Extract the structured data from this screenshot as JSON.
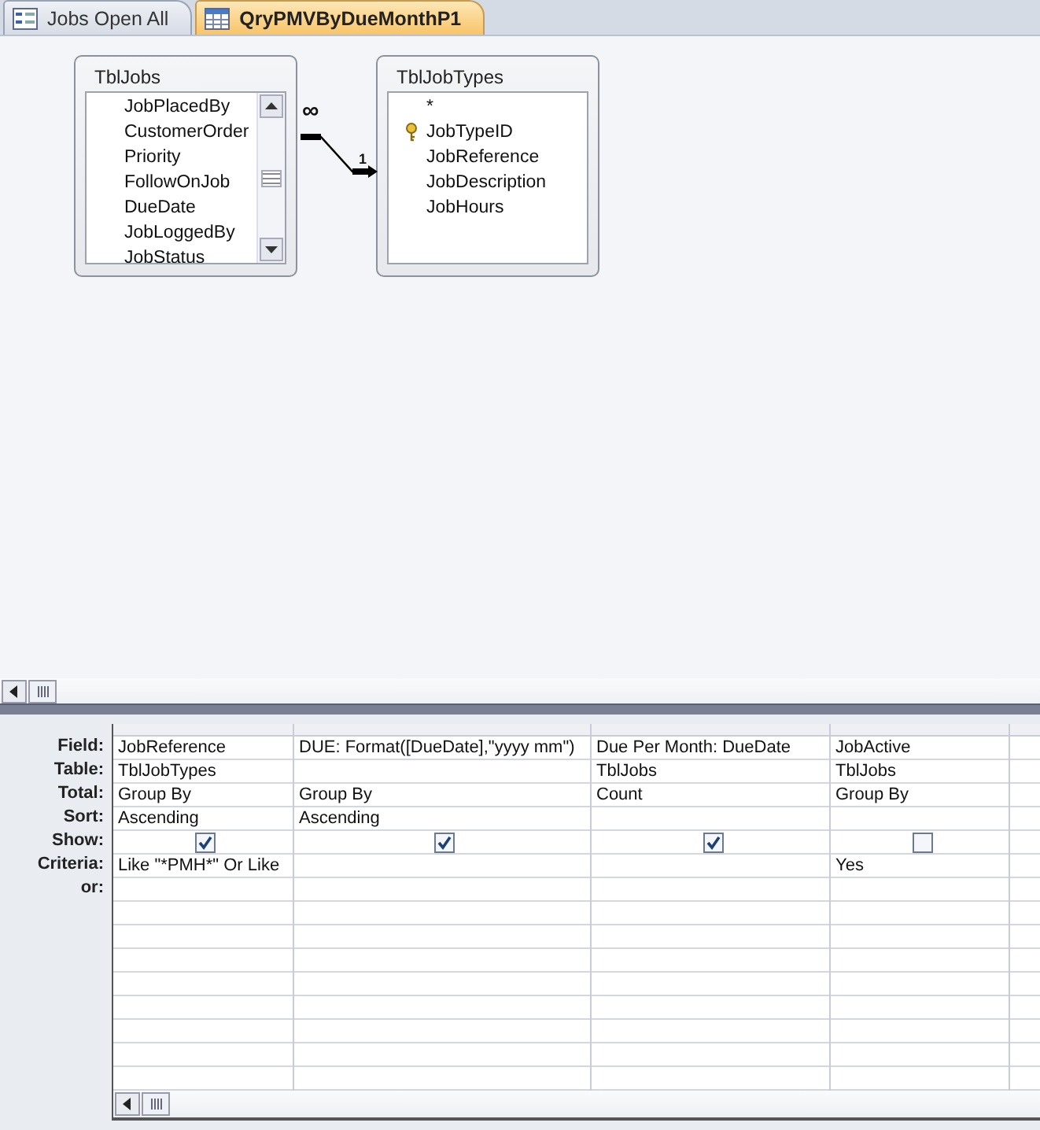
{
  "tabs": [
    {
      "label": "Jobs Open All",
      "kind": "form",
      "selected": false
    },
    {
      "label": "QryPMVByDueMonthP1",
      "kind": "query",
      "selected": true
    }
  ],
  "tables": [
    {
      "title": "TblJobs",
      "scrollable": true,
      "fields": [
        {
          "name": "JobPlacedBy",
          "key": false
        },
        {
          "name": "CustomerOrder",
          "key": false
        },
        {
          "name": "Priority",
          "key": false
        },
        {
          "name": "FollowOnJob",
          "key": false
        },
        {
          "name": "DueDate",
          "key": false
        },
        {
          "name": "JobLoggedBy",
          "key": false
        },
        {
          "name": "JobStatus",
          "key": false
        }
      ]
    },
    {
      "title": "TblJobTypes",
      "scrollable": false,
      "fields": [
        {
          "name": "*",
          "key": false
        },
        {
          "name": "JobTypeID",
          "key": true
        },
        {
          "name": "JobReference",
          "key": false
        },
        {
          "name": "JobDescription",
          "key": false
        },
        {
          "name": "JobHours",
          "key": false
        }
      ]
    }
  ],
  "relationship": {
    "many_label": "∞",
    "one_label": "1"
  },
  "grid": {
    "row_labels": [
      "Field:",
      "Table:",
      "Total:",
      "Sort:",
      "Show:",
      "Criteria:",
      "or:"
    ],
    "columns": [
      {
        "field": "JobReference",
        "table": "TblJobTypes",
        "total": "Group By",
        "sort": "Ascending",
        "show": true,
        "criteria": "Like \"*PMH*\" Or Like"
      },
      {
        "field": "DUE: Format([DueDate],\"yyyy mm\")",
        "total": "Group By",
        "sort": "Ascending",
        "show": true
      },
      {
        "field": "Due Per Month: DueDate",
        "table": "TblJobs",
        "total": "Count",
        "show": true
      },
      {
        "field": "JobActive",
        "table": "TblJobs",
        "total": "Group By",
        "show": false,
        "criteria": "Yes"
      }
    ]
  }
}
